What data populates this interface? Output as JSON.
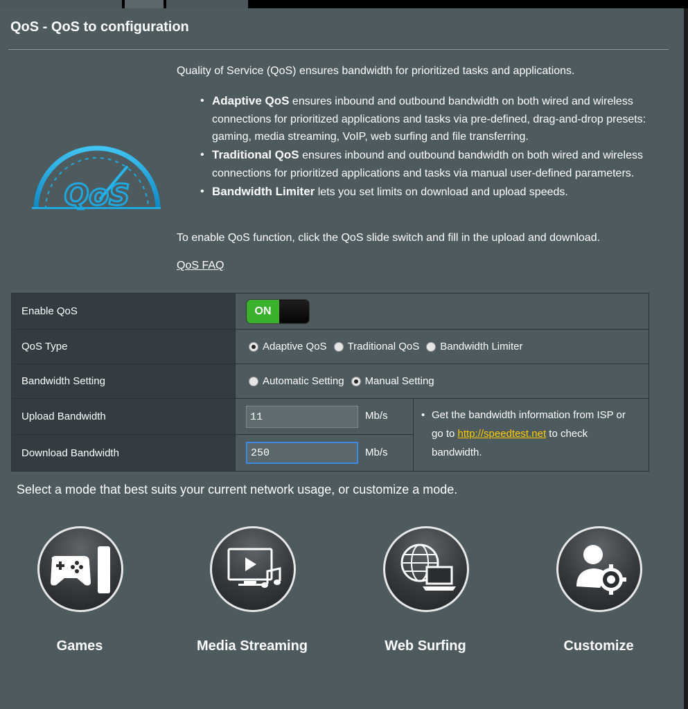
{
  "page": {
    "title": "QoS - QoS to configuration"
  },
  "logo": {
    "text": "QoS"
  },
  "intro": {
    "lead": "Quality of Service (QoS) ensures bandwidth for prioritized tasks and applications.",
    "bullets": [
      {
        "term": "Adaptive QoS",
        "text": " ensures inbound and outbound bandwidth on both wired and wireless connections for prioritized applications and tasks via pre-defined, drag-and-drop presets: gaming, media streaming, VoIP, web surfing and file transferring."
      },
      {
        "term": "Traditional QoS",
        "text": " ensures inbound and outbound bandwidth on both wired and wireless connections for prioritized applications and tasks via manual user-defined parameters."
      },
      {
        "term": "Bandwidth Limiter",
        "text": " lets you set limits on download and upload speeds."
      }
    ],
    "enable_note": "To enable QoS function, click the QoS slide switch and fill in the upload and download.",
    "faq_link": "QoS FAQ"
  },
  "settings": {
    "enable_qos": {
      "label": "Enable QoS",
      "toggle_text": "ON"
    },
    "qos_type": {
      "label": "QoS Type",
      "options": [
        "Adaptive QoS",
        "Traditional QoS",
        "Bandwidth Limiter"
      ],
      "selected": "Adaptive QoS"
    },
    "bandwidth_setting": {
      "label": "Bandwidth Setting",
      "options": [
        "Automatic Setting",
        "Manual Setting"
      ],
      "selected": "Manual Setting"
    },
    "upload": {
      "label": "Upload Bandwidth",
      "value": "11",
      "unit": "Mb/s"
    },
    "download": {
      "label": "Download Bandwidth",
      "value": "250",
      "unit": "Mb/s"
    },
    "isp_note": {
      "before": "Get the bandwidth information from ISP or go to ",
      "link": "http://speedtest.net",
      "after": " to check bandwidth."
    }
  },
  "modes": {
    "prompt": "Select a mode that best suits your current network usage, or customize a mode.",
    "items": [
      {
        "label": "Games",
        "icon": "gamepad-icon"
      },
      {
        "label": "Media Streaming",
        "icon": "media-streaming-icon"
      },
      {
        "label": "Web Surfing",
        "icon": "web-surfing-icon"
      },
      {
        "label": "Customize",
        "icon": "customize-user-gear-icon"
      }
    ]
  },
  "colors": {
    "panel": "#4d5a5e",
    "label_cell": "#333d41",
    "toggle_on": "#3bb02c",
    "link": "#ffcc00",
    "logo": "#1fa8e0"
  }
}
